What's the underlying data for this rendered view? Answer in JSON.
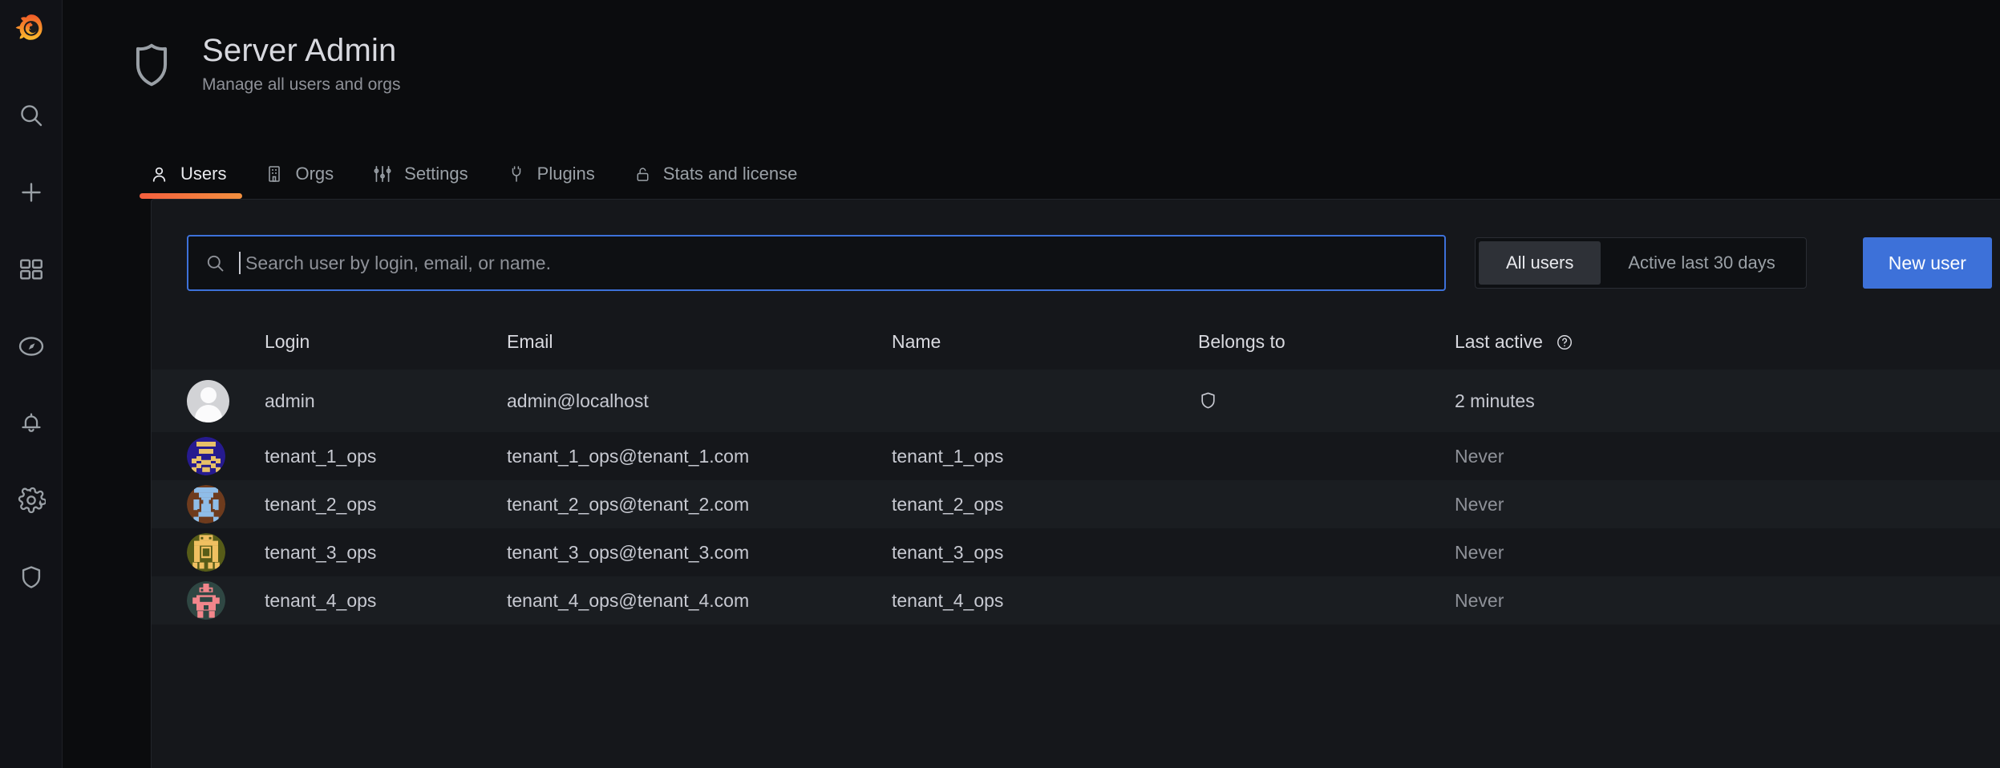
{
  "colors": {
    "accent_orange": "#f55f3e",
    "accent_orange_2": "#f2903f",
    "primary_blue": "#3d71d9",
    "panel_bg": "#15171b",
    "page_bg": "#0b0c0e",
    "sidebar_bg": "#111217",
    "text_primary": "#d8d9df",
    "text_secondary": "#8e9198",
    "row_stripe": "#1a1d21"
  },
  "sidebar": {
    "logo": "grafana-logo",
    "items": [
      {
        "icon": "search-icon",
        "label": "Search"
      },
      {
        "icon": "plus-icon",
        "label": "Create"
      },
      {
        "icon": "dashboards-icon",
        "label": "Dashboards"
      },
      {
        "icon": "compass-icon",
        "label": "Explore"
      },
      {
        "icon": "bell-icon",
        "label": "Alerting"
      },
      {
        "icon": "gear-icon",
        "label": "Configuration"
      },
      {
        "icon": "shield-icon",
        "label": "Server Admin"
      }
    ]
  },
  "header": {
    "icon": "shield-icon",
    "title": "Server Admin",
    "subtitle": "Manage all users and orgs"
  },
  "tabs": [
    {
      "label": "Users",
      "icon": "user-icon",
      "active": true
    },
    {
      "label": "Orgs",
      "icon": "building-icon",
      "active": false
    },
    {
      "label": "Settings",
      "icon": "sliders-icon",
      "active": false
    },
    {
      "label": "Plugins",
      "icon": "plug-icon",
      "active": false
    },
    {
      "label": "Stats and license",
      "icon": "unlock-icon",
      "active": false
    }
  ],
  "toolbar": {
    "search": {
      "value": "",
      "placeholder": "Search user by login, email, or name.",
      "icon": "search-icon",
      "focused": true
    },
    "filters": [
      {
        "label": "All users",
        "selected": true
      },
      {
        "label": "Active last 30 days",
        "selected": false
      }
    ],
    "new_user_label": "New user"
  },
  "table": {
    "columns": [
      {
        "key": "login",
        "label": "Login"
      },
      {
        "key": "email",
        "label": "Email"
      },
      {
        "key": "name",
        "label": "Name"
      },
      {
        "key": "belongs",
        "label": "Belongs to"
      },
      {
        "key": "last",
        "label": "Last active",
        "help": "help-circle-icon"
      }
    ],
    "rows": [
      {
        "avatar": "default-user-gravatar",
        "login": "admin",
        "email": "admin@localhost",
        "name": "",
        "belongs_icon": "shield-icon",
        "last_active": "2 minutes",
        "last_active_muted": false
      },
      {
        "avatar": "identicon-indigo",
        "login": "tenant_1_ops",
        "email": "tenant_1_ops@tenant_1.com",
        "name": "tenant_1_ops",
        "belongs_icon": "",
        "last_active": "Never",
        "last_active_muted": true
      },
      {
        "avatar": "identicon-brown",
        "login": "tenant_2_ops",
        "email": "tenant_2_ops@tenant_2.com",
        "name": "tenant_2_ops",
        "belongs_icon": "",
        "last_active": "Never",
        "last_active_muted": true
      },
      {
        "avatar": "identicon-olive",
        "login": "tenant_3_ops",
        "email": "tenant_3_ops@tenant_3.com",
        "name": "tenant_3_ops",
        "belongs_icon": "",
        "last_active": "Never",
        "last_active_muted": true
      },
      {
        "avatar": "identicon-teal",
        "login": "tenant_4_ops",
        "email": "tenant_4_ops@tenant_4.com",
        "name": "tenant_4_ops",
        "belongs_icon": "",
        "last_active": "Never",
        "last_active_muted": true
      }
    ]
  }
}
